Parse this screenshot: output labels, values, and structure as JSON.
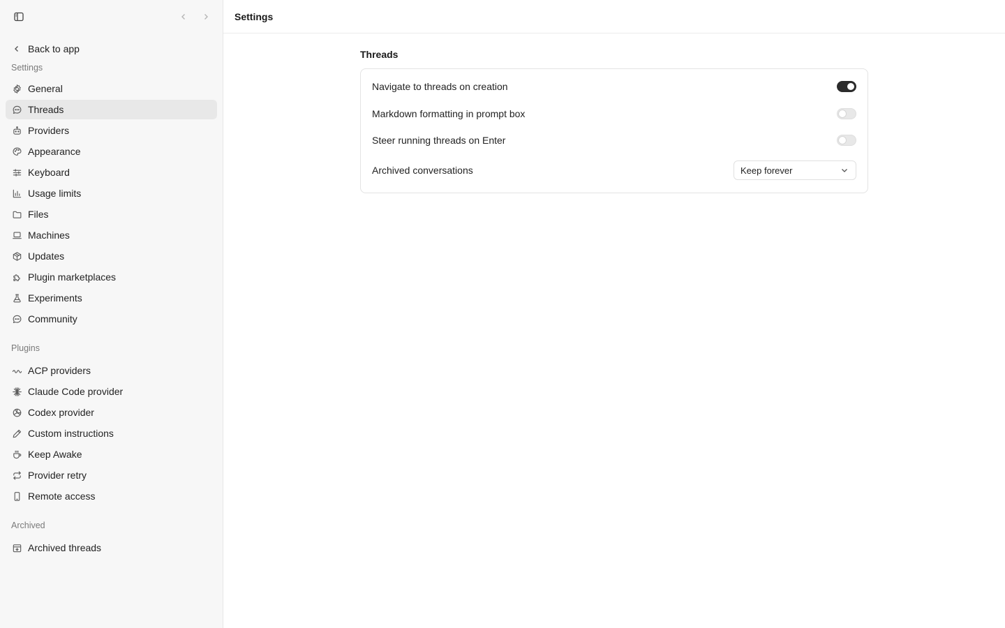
{
  "sidebar": {
    "back_label": "Back to app",
    "sections": [
      {
        "label": "Settings",
        "items": [
          {
            "label": "General",
            "icon": "gear-icon"
          },
          {
            "label": "Threads",
            "icon": "chat-bubble-icon",
            "active": true
          },
          {
            "label": "Providers",
            "icon": "robot-icon"
          },
          {
            "label": "Appearance",
            "icon": "palette-icon"
          },
          {
            "label": "Keyboard",
            "icon": "sliders-icon"
          },
          {
            "label": "Usage limits",
            "icon": "bar-chart-icon"
          },
          {
            "label": "Files",
            "icon": "folder-icon"
          },
          {
            "label": "Machines",
            "icon": "laptop-icon"
          },
          {
            "label": "Updates",
            "icon": "package-icon"
          },
          {
            "label": "Plugin marketplaces",
            "icon": "puzzle-icon"
          },
          {
            "label": "Experiments",
            "icon": "flask-icon"
          },
          {
            "label": "Community",
            "icon": "chat-bubble-icon"
          }
        ]
      },
      {
        "label": "Plugins",
        "items": [
          {
            "label": "ACP providers",
            "icon": "acp-icon"
          },
          {
            "label": "Claude Code provider",
            "icon": "asterisk-icon"
          },
          {
            "label": "Codex provider",
            "icon": "openai-icon"
          },
          {
            "label": "Custom instructions",
            "icon": "pencil-icon"
          },
          {
            "label": "Keep Awake",
            "icon": "coffee-icon"
          },
          {
            "label": "Provider retry",
            "icon": "repeat-icon"
          },
          {
            "label": "Remote access",
            "icon": "phone-icon"
          }
        ]
      },
      {
        "label": "Archived",
        "items": [
          {
            "label": "Archived threads",
            "icon": "archive-icon"
          }
        ]
      }
    ]
  },
  "header": {
    "title": "Settings"
  },
  "threads": {
    "title": "Threads",
    "rows": [
      {
        "label": "Navigate to threads on creation",
        "enabled": true
      },
      {
        "label": "Markdown formatting in prompt box",
        "enabled": false
      },
      {
        "label": "Steer running threads on Enter",
        "enabled": false
      }
    ],
    "archived": {
      "label": "Archived conversations",
      "value": "Keep forever"
    }
  },
  "colors": {
    "accent": "#2b2b2b",
    "sidebar_bg": "#f7f7f7",
    "active_bg": "#e8e8e8"
  }
}
